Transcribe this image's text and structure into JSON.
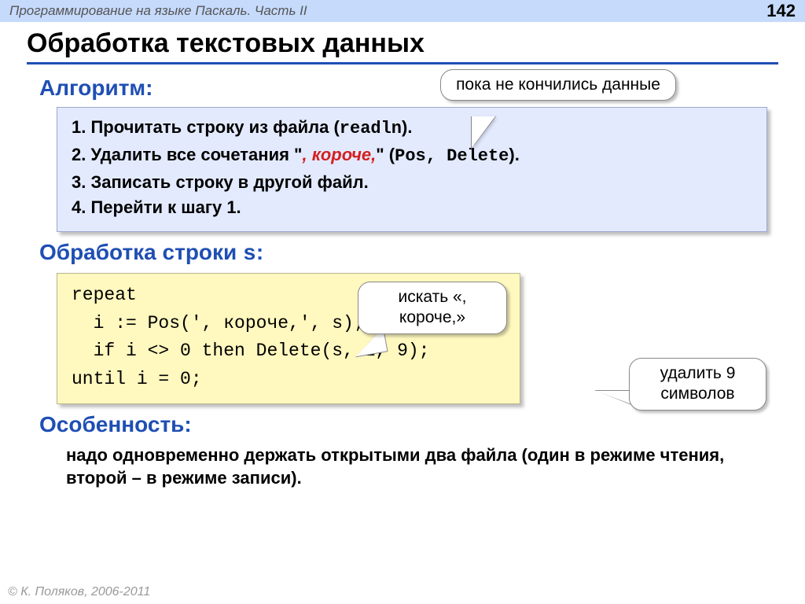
{
  "topbar": {
    "subject": "Программирование на языке Паскаль. Часть II",
    "page": "142"
  },
  "title": "Обработка текстовых данных",
  "sections": {
    "algorithm": "Алгоритм:",
    "processing_pre": "Обработка строки ",
    "processing_var": "s",
    "processing_post": ":",
    "feature": "Особенность:"
  },
  "algo": {
    "step1_a": "1. Прочитать строку из файла (",
    "step1_b": "readln",
    "step1_c": ").",
    "step2_a": "2. Удалить все сочетания \"",
    "step2_b": ", короче,",
    "step2_c": "\" (",
    "step2_d": "Pos",
    "step2_e": ", ",
    "step2_f": "Delete",
    "step2_g": ").",
    "step3": "3. Записать строку в другой файл.",
    "step4": "4. Перейти к шагу 1."
  },
  "code": {
    "l1": "repeat",
    "l2": "  i := Pos(', короче,', s);",
    "l3": "  if i <> 0 then Delete(s, i, 9);",
    "l4": "until i = 0;"
  },
  "bubbles": {
    "b1": "пока не кончились данные",
    "b2": "искать «, короче,»",
    "b3": "удалить 9 символов"
  },
  "feature_text": "надо одновременно держать открытыми два файла (один в режиме чтения, второй – в режиме записи).",
  "footer": "© К. Поляков, 2006-2011"
}
